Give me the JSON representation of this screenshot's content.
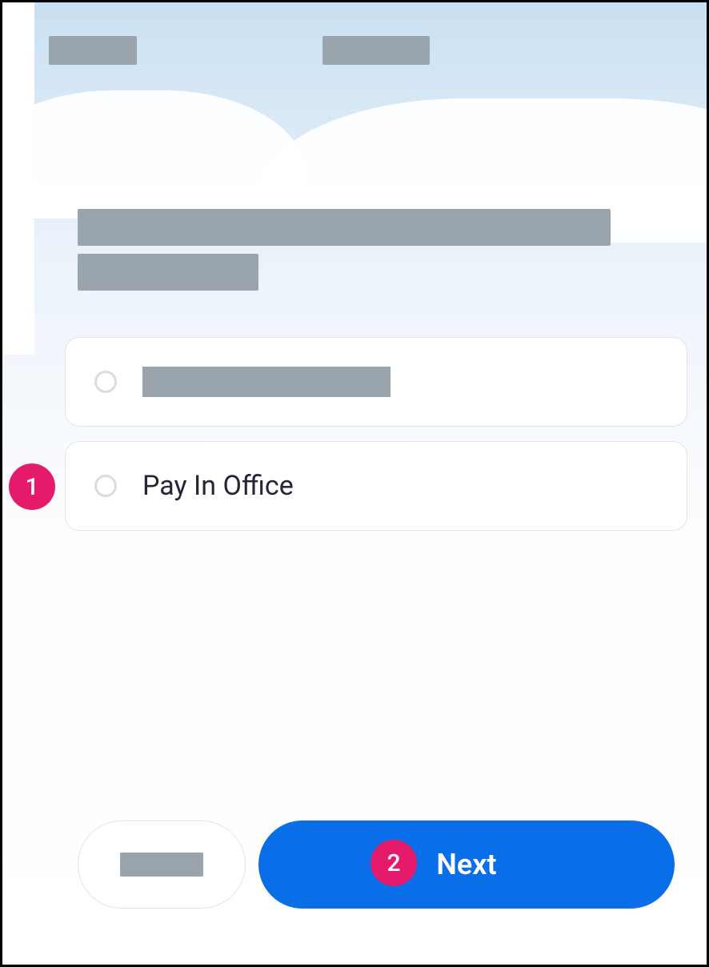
{
  "options": {
    "pay_in_office": "Pay In Office"
  },
  "buttons": {
    "next": "Next"
  },
  "callouts": {
    "one": "1",
    "two": "2"
  }
}
